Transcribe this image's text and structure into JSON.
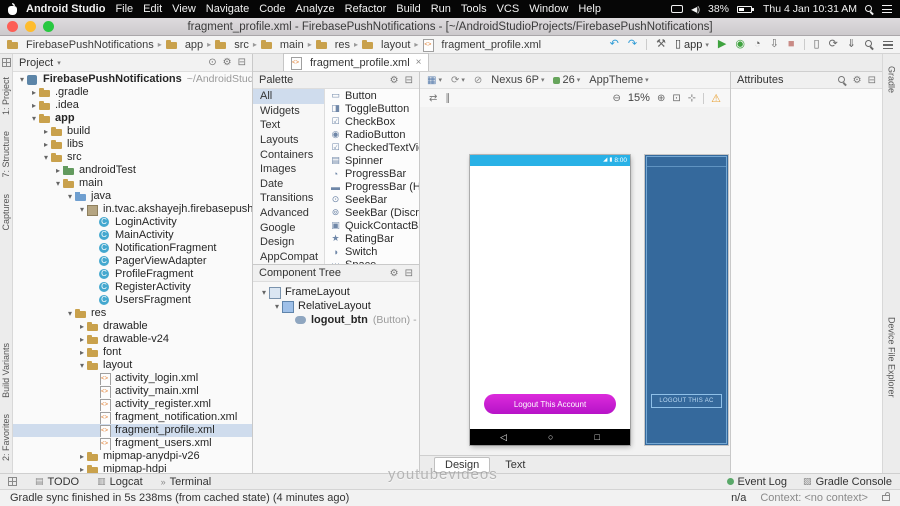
{
  "colors": {
    "phone_statusbar_blue": "#29b1e6",
    "button_magenta": "#b613c8",
    "blueprint_blue": "#35699c",
    "run_green": "#3fa33f",
    "warning_orange": "#e8a033",
    "accent_blue": "#2e9bd6"
  },
  "icons": {
    "chevron-down": "▾",
    "chevron-right": "▸",
    "close": "×",
    "gear": "⚙",
    "collapse": "⊟",
    "locate": "⊙",
    "undo": "↶",
    "redo": "↷",
    "hammer": "⚒",
    "run": "▶",
    "debug": "◉",
    "profiler": "◔",
    "attach": "⇩",
    "stop": "■",
    "device": "▯",
    "sync": "⟳",
    "sdk": "⇓",
    "surface": "▦",
    "orientation": "⟳",
    "no-night": "⊘",
    "zoom-out": "⊖",
    "zoom-in": "⊕",
    "zoom-fit": "⊡",
    "pan": "⊹",
    "warning": "⚠",
    "swap": "⇄",
    "ruler": "∥",
    "back": "◁",
    "home": "○",
    "recents": "□",
    "wifi": "◢",
    "batt": "▮",
    "widget-button": "▭",
    "widget-toggle": "◨",
    "widget-checkbox": "☑",
    "widget-radio": "◉",
    "widget-checkedtext": "☑",
    "widget-spinner": "▤",
    "widget-progress": "◔",
    "widget-progress-h": "▬",
    "widget-seekbar": "⊙",
    "widget-seekbar-d": "⊚",
    "widget-quickcontact": "▣",
    "widget-rating": "★",
    "widget-switch": "◑",
    "widget-space": "⋯",
    "tool-todo": "▤",
    "tool-logcat": "▥",
    "tool-terminal": "»",
    "tool-gradle-console": "▧"
  },
  "menu_bar": {
    "items": [
      "Android Studio",
      "File",
      "Edit",
      "View",
      "Navigate",
      "Code",
      "Analyze",
      "Refactor",
      "Build",
      "Run",
      "Tools",
      "VCS",
      "Window",
      "Help"
    ],
    "battery": "38%",
    "clock": "Thu 4 Jan 10:31 AM"
  },
  "window": {
    "title": "fragment_profile.xml - FirebasePushNotifications - [~/AndroidStudioProjects/FirebasePushNotifications]"
  },
  "nav_toolbar": {
    "breadcrumbs": [
      {
        "label": "FirebasePushNotifications",
        "icon": "folder"
      },
      {
        "label": "app",
        "icon": "folder"
      },
      {
        "label": "src",
        "icon": "folder"
      },
      {
        "label": "main",
        "icon": "folder"
      },
      {
        "label": "res",
        "icon": "folder"
      },
      {
        "label": "layout",
        "icon": "folder"
      },
      {
        "label": "fragment_profile.xml",
        "icon": "xml"
      }
    ],
    "run_config": "app"
  },
  "left_strip": {
    "top": [
      "1: Project",
      "7: Structure",
      "Captures"
    ],
    "bottom": [
      "Build Variants",
      "2: Favorites"
    ]
  },
  "right_strip": [
    "Gradle",
    "Device File Explorer"
  ],
  "project_panel": {
    "header": "Project",
    "tree": [
      {
        "label": "FirebasePushNotifications",
        "suffix": "~/AndroidStudioProj",
        "level": 0,
        "arrow": "down",
        "icon": "project",
        "bold": true
      },
      {
        "label": ".gradle",
        "level": 1,
        "arrow": "right",
        "icon": "folder"
      },
      {
        "label": ".idea",
        "level": 1,
        "arrow": "right",
        "icon": "folder"
      },
      {
        "label": "app",
        "level": 1,
        "arrow": "down",
        "icon": "module",
        "bold": true
      },
      {
        "label": "build",
        "level": 2,
        "arrow": "right",
        "icon": "folder"
      },
      {
        "label": "libs",
        "level": 2,
        "arrow": "right",
        "icon": "folder"
      },
      {
        "label": "src",
        "level": 2,
        "arrow": "down",
        "icon": "folder"
      },
      {
        "label": "androidTest",
        "level": 3,
        "arrow": "right",
        "icon": "folder-green"
      },
      {
        "label": "main",
        "level": 3,
        "arrow": "down",
        "icon": "folder"
      },
      {
        "label": "java",
        "level": 4,
        "arrow": "down",
        "icon": "folder-blue"
      },
      {
        "label": "in.tvac.akshayejh.firebasepushno",
        "level": 5,
        "arrow": "down",
        "icon": "package"
      },
      {
        "label": "LoginActivity",
        "level": 6,
        "arrow": "none",
        "icon": "class"
      },
      {
        "label": "MainActivity",
        "level": 6,
        "arrow": "none",
        "icon": "class"
      },
      {
        "label": "NotificationFragment",
        "level": 6,
        "arrow": "none",
        "icon": "class"
      },
      {
        "label": "PagerViewAdapter",
        "level": 6,
        "arrow": "none",
        "icon": "class"
      },
      {
        "label": "ProfileFragment",
        "level": 6,
        "arrow": "none",
        "icon": "class"
      },
      {
        "label": "RegisterActivity",
        "level": 6,
        "arrow": "none",
        "icon": "class"
      },
      {
        "label": "UsersFragment",
        "level": 6,
        "arrow": "none",
        "icon": "class"
      },
      {
        "label": "res",
        "level": 4,
        "arrow": "down",
        "icon": "folder"
      },
      {
        "label": "drawable",
        "level": 5,
        "arrow": "right",
        "icon": "folder"
      },
      {
        "label": "drawable-v24",
        "level": 5,
        "arrow": "right",
        "icon": "folder"
      },
      {
        "label": "font",
        "level": 5,
        "arrow": "right",
        "icon": "folder"
      },
      {
        "label": "layout",
        "level": 5,
        "arrow": "down",
        "icon": "folder"
      },
      {
        "label": "activity_login.xml",
        "level": 6,
        "arrow": "none",
        "icon": "xml"
      },
      {
        "label": "activity_main.xml",
        "level": 6,
        "arrow": "none",
        "icon": "xml"
      },
      {
        "label": "activity_register.xml",
        "level": 6,
        "arrow": "none",
        "icon": "xml"
      },
      {
        "label": "fragment_notification.xml",
        "level": 6,
        "arrow": "none",
        "icon": "xml"
      },
      {
        "label": "fragment_profile.xml",
        "level": 6,
        "arrow": "none",
        "icon": "xml",
        "selected": true
      },
      {
        "label": "fragment_users.xml",
        "level": 6,
        "arrow": "none",
        "icon": "xml"
      },
      {
        "label": "mipmap-anydpi-v26",
        "level": 5,
        "arrow": "right",
        "icon": "folder"
      },
      {
        "label": "mipmap-hdpi",
        "level": 5,
        "arrow": "right",
        "icon": "folder"
      }
    ]
  },
  "editor_tab": "fragment_profile.xml",
  "palette": {
    "header": "Palette",
    "categories": [
      "All",
      "Widgets",
      "Text",
      "Layouts",
      "Containers",
      "Images",
      "Date",
      "Transitions",
      "Advanced",
      "Google",
      "Design",
      "AppCompat"
    ],
    "active_category": "All",
    "widgets": [
      {
        "label": "Button",
        "icon": "widget-button"
      },
      {
        "label": "ToggleButton",
        "icon": "widget-toggle"
      },
      {
        "label": "CheckBox",
        "icon": "widget-checkbox"
      },
      {
        "label": "RadioButton",
        "icon": "widget-radio"
      },
      {
        "label": "CheckedTextView",
        "icon": "widget-checkedtext"
      },
      {
        "label": "Spinner",
        "icon": "widget-spinner"
      },
      {
        "label": "ProgressBar",
        "icon": "widget-progress"
      },
      {
        "label": "ProgressBar (Hor",
        "icon": "widget-progress-h"
      },
      {
        "label": "SeekBar",
        "icon": "widget-seekbar"
      },
      {
        "label": "SeekBar (Discret",
        "icon": "widget-seekbar-d"
      },
      {
        "label": "QuickContactBad",
        "icon": "widget-quickcontact"
      },
      {
        "label": "RatingBar",
        "icon": "widget-rating"
      },
      {
        "label": "Switch",
        "icon": "widget-switch"
      },
      {
        "label": "Space",
        "icon": "widget-space"
      }
    ]
  },
  "component_tree": {
    "header": "Component Tree",
    "nodes": [
      {
        "label": "FrameLayout",
        "icon": "frame-layout",
        "level": 0,
        "arrow": "down"
      },
      {
        "label": "RelativeLayout",
        "icon": "relative-layout",
        "level": 1,
        "arrow": "down"
      },
      {
        "label": "logout_btn",
        "suffix": "(Button) -",
        "icon": "button",
        "level": 2,
        "bold": true
      }
    ]
  },
  "design_editor": {
    "toolbar": {
      "device": "Nexus 6P",
      "api": "26",
      "theme": "AppTheme"
    },
    "zoom": "15%",
    "phone_preview": {
      "status_time": "8:00",
      "button_label": "Logout This Account"
    },
    "blueprint": {
      "button_label": "LOGOUT THIS AC"
    },
    "bottom_tabs": [
      "Design",
      "Text"
    ],
    "active_tab": "Design"
  },
  "attributes_panel": {
    "header": "Attributes"
  },
  "tool_buttons_bottom": {
    "left": [
      "TODO",
      "Logcat",
      "Terminal"
    ],
    "right": [
      "Event Log",
      "Gradle Console"
    ]
  },
  "status_bar": {
    "message": "Gradle sync finished in 5s 238ms (from cached state) (4 minutes ago)",
    "na": "n/a",
    "context": "Context: <no context>"
  },
  "watermark": "youtubevideos"
}
